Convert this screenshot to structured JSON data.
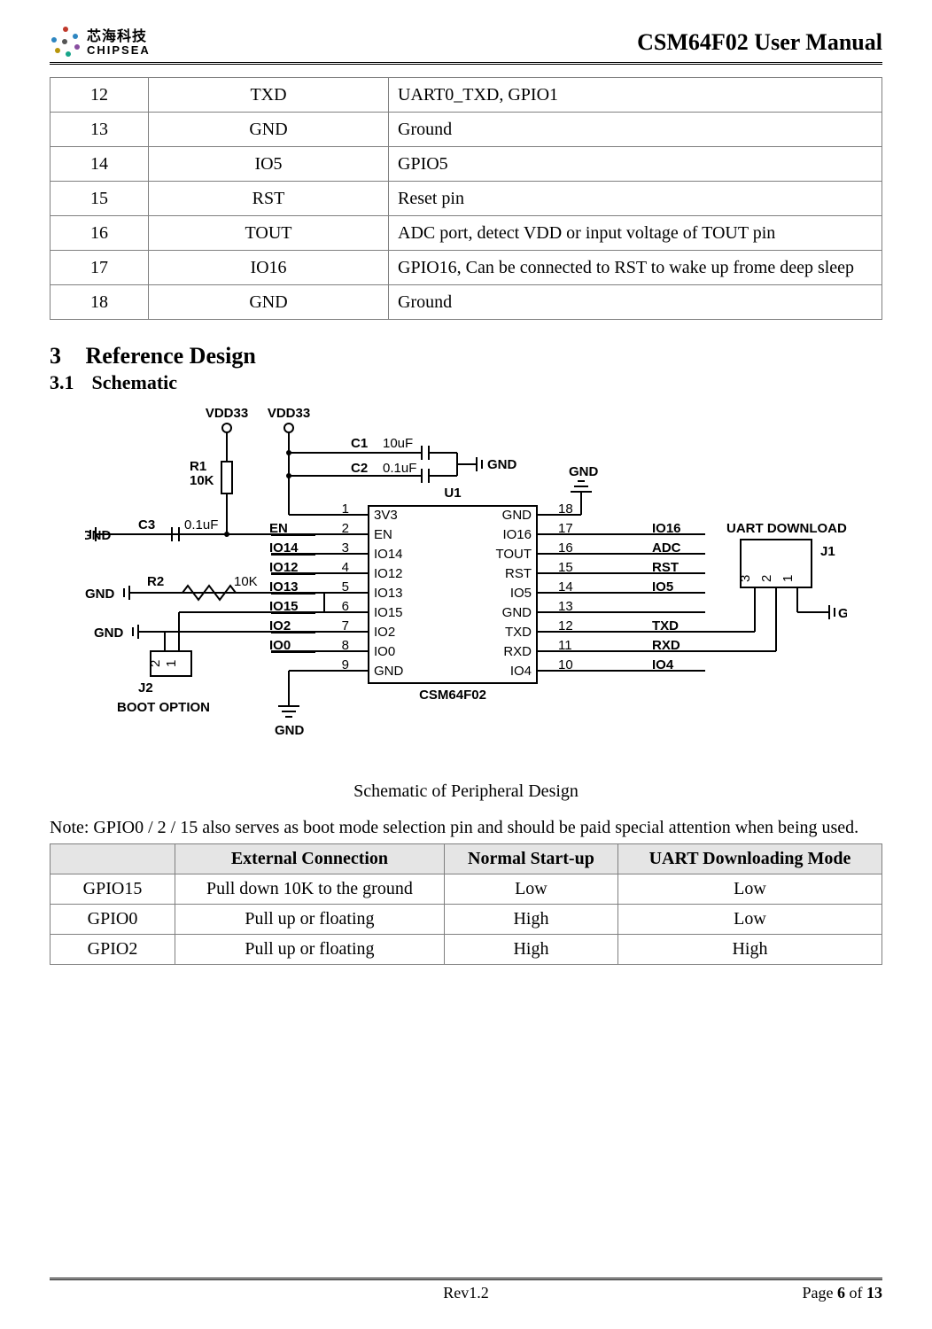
{
  "header": {
    "logo_cn": "芯海科技",
    "logo_en": "CHIPSEA",
    "doc_title": "CSM64F02 User Manual"
  },
  "pin_table": {
    "rows": [
      {
        "num": "12",
        "name": "TXD",
        "desc": "UART0_TXD,  GPIO1"
      },
      {
        "num": "13",
        "name": "GND",
        "desc": "Ground"
      },
      {
        "num": "14",
        "name": "IO5",
        "desc": "GPIO5"
      },
      {
        "num": "15",
        "name": "RST",
        "desc": "Reset pin"
      },
      {
        "num": "16",
        "name": "TOUT",
        "desc": "ADC port, detect VDD or input voltage of TOUT pin"
      },
      {
        "num": "17",
        "name": "IO16",
        "desc": "GPIO16, Can be connected to RST to wake up frome deep sleep"
      },
      {
        "num": "18",
        "name": "GND",
        "desc": "Ground"
      }
    ]
  },
  "section": {
    "num": "3",
    "title": "Reference Design",
    "sub_num": "3.1",
    "sub_title": "Schematic"
  },
  "schematic": {
    "caption": "Schematic of Peripheral Design",
    "labels": {
      "vdd33_a": "VDD33",
      "vdd33_b": "VDD33",
      "r1": "R1",
      "r1v": "10K",
      "c1": "C1",
      "c1v": "10uF",
      "c2": "C2",
      "c2v": "0.1uF",
      "c3": "C3",
      "c3v": "0.1uF",
      "r2": "R2",
      "r2v": "10K",
      "u1": "U1",
      "chip": "CSM64F02",
      "gnd": "GND",
      "gnd_top": "GND",
      "gnd_right": "GND",
      "j1": "J1",
      "j2": "J2",
      "boot": "BOOT OPTION",
      "uart_dl": "UART DOWNLOAD",
      "left_pins": [
        "3V3",
        "EN",
        "IO14",
        "IO12",
        "IO13",
        "IO15",
        "IO2",
        "IO0",
        "GND"
      ],
      "left_nums": [
        "1",
        "2",
        "3",
        "4",
        "5",
        "6",
        "7",
        "8",
        "9"
      ],
      "right_pins": [
        "GND",
        "IO16",
        "TOUT",
        "RST",
        "IO5",
        "GND",
        "TXD",
        "RXD",
        "IO4"
      ],
      "right_nums": [
        "18",
        "17",
        "16",
        "15",
        "14",
        "13",
        "12",
        "11",
        "10"
      ],
      "left_ext": [
        "EN",
        "IO14",
        "IO12",
        "IO13",
        "IO15",
        "IO2",
        "IO0"
      ],
      "right_ext": [
        "IO16",
        "ADC",
        "RST",
        "IO5",
        "",
        "TXD",
        "RXD",
        "IO4"
      ],
      "j1_pins": [
        "3",
        "2",
        "1"
      ],
      "j2_pins": [
        "2",
        "1"
      ]
    }
  },
  "note_text": "Note: GPIO0 / 2 / 15 also serves as boot mode selection pin and should be paid special attention when being used.",
  "mode_table": {
    "headers": [
      "",
      "External Connection",
      "Normal Start-up",
      "UART Downloading Mode"
    ],
    "rows": [
      {
        "pin": "GPIO15",
        "ext": "Pull down 10K to the ground",
        "normal": "Low",
        "uart": "Low"
      },
      {
        "pin": "GPIO0",
        "ext": "Pull up or floating",
        "normal": "High",
        "uart": "Low"
      },
      {
        "pin": "GPIO2",
        "ext": "Pull up or floating",
        "normal": "High",
        "uart": "High"
      }
    ]
  },
  "footer": {
    "rev": "Rev1.2",
    "page_prefix": "Page ",
    "page_num": "6",
    "page_mid": " of ",
    "page_total": "13"
  }
}
